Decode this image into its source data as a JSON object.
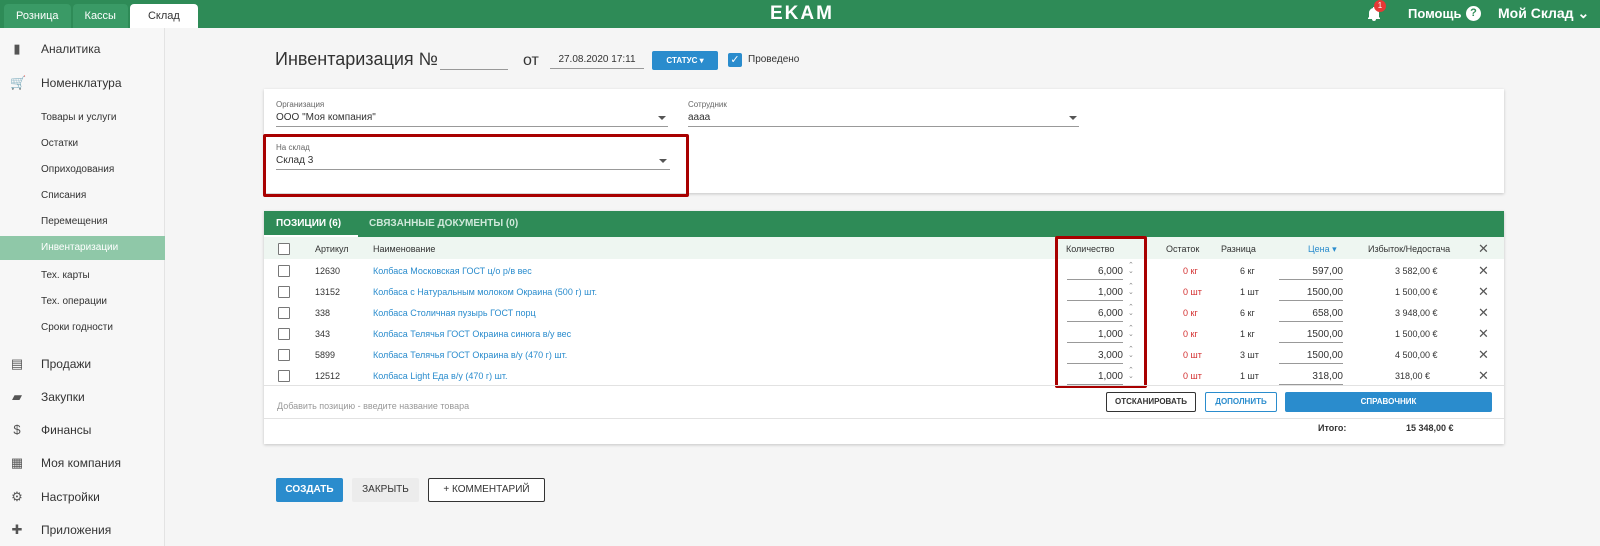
{
  "top_tabs": [
    "Розница",
    "Кассы",
    "Склад"
  ],
  "logo": "EKAM",
  "notif_count": "1",
  "help": "Помощь",
  "help_mark": "?",
  "my_shop": "Мой Склад",
  "sidebar": {
    "analytics": "Аналитика",
    "nomenclature": "Номенклатура",
    "subs": [
      "Товары и услуги",
      "Остатки",
      "Оприходования",
      "Списания",
      "Перемещения",
      "Инвентаризации",
      "Тех. карты",
      "Тех. операции",
      "Сроки годности"
    ],
    "sales": "Продажи",
    "purchases": "Закупки",
    "finance": "Финансы",
    "company": "Моя компания",
    "settings": "Настройки",
    "apps": "Приложения"
  },
  "header": {
    "title": "Инвентаризация №",
    "from": "от",
    "date": "27.08.2020 17:11",
    "status": "СТАТУС",
    "posted": "Проведено"
  },
  "form": {
    "org_label": "Организация",
    "org_value": "ООО \"Моя компания\"",
    "emp_label": "Сотрудник",
    "emp_value": "аааа",
    "wh_label": "На склад",
    "wh_value": "Склад 3"
  },
  "table_tabs": {
    "positions": "ПОЗИЦИИ (6)",
    "docs": "СВЯЗАННЫЕ ДОКУМЕНТЫ (0)"
  },
  "columns": {
    "article": "Артикул",
    "name": "Наименование",
    "qty": "Количество",
    "rest": "Остаток",
    "diff": "Разница",
    "price": "Цена",
    "surplus": "Избыток/Недостача"
  },
  "rows": [
    {
      "article": "12630",
      "name": "Колбаса Московская ГОСТ ц/о р/в вес",
      "qty": "6,000",
      "rest": "0 кг",
      "diff": "6 кг",
      "price": "597,00",
      "surplus": "3 582,00 €"
    },
    {
      "article": "13152",
      "name": "Колбаса с Натуральным молоком Окраина (500 г) шт.",
      "qty": "1,000",
      "rest": "0 шт",
      "diff": "1 шт",
      "price": "1500,00",
      "surplus": "1 500,00 €"
    },
    {
      "article": "338",
      "name": "Колбаса Столичная пузырь ГОСТ порц",
      "qty": "6,000",
      "rest": "0 кг",
      "diff": "6 кг",
      "price": "658,00",
      "surplus": "3 948,00 €"
    },
    {
      "article": "343",
      "name": "Колбаса Телячья ГОСТ Окраина синюга в/у вес",
      "qty": "1,000",
      "rest": "0 кг",
      "diff": "1 кг",
      "price": "1500,00",
      "surplus": "1 500,00 €"
    },
    {
      "article": "5899",
      "name": "Колбаса Телячья ГОСТ Окраина в/у (470 г) шт.",
      "qty": "3,000",
      "rest": "0 шт",
      "diff": "3 шт",
      "price": "1500,00",
      "surplus": "4 500,00 €"
    },
    {
      "article": "12512",
      "name": "Колбаса Light Еда в/у (470 г) шт.",
      "qty": "1,000",
      "rest": "0 шт",
      "diff": "1 шт",
      "price": "318,00",
      "surplus": "318,00 €"
    }
  ],
  "add_placeholder": "Добавить позицию - введите название товара",
  "buttons": {
    "scan": "ОТСКАНИРОВАТЬ",
    "fill": "ДОПОЛНИТЬ",
    "catalog": "СПРАВОЧНИК",
    "create": "СОЗДАТЬ",
    "close": "ЗАКРЫТЬ",
    "comment": "КОММЕНТАРИЙ"
  },
  "total_label": "Итого:",
  "total_value": "15 348,00 €",
  "colors": {
    "green": "#2e8b57",
    "blue": "#2a8ccd",
    "red": "#a80000"
  }
}
